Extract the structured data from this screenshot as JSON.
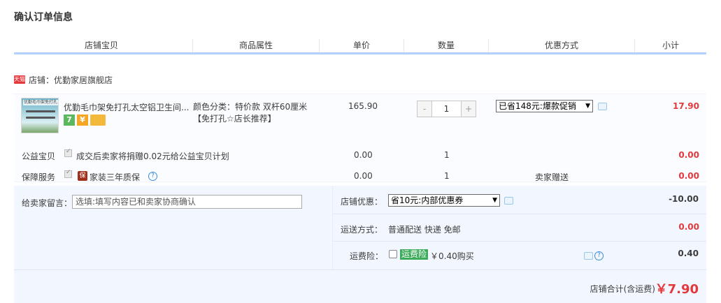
{
  "page_title": "确认订单信息",
  "columns": [
    "店铺宝贝",
    "商品属性",
    "单价",
    "数量",
    "优惠方式",
    "小计"
  ],
  "shop": {
    "badge": "天猫",
    "label": "店铺：",
    "name": "优勤家居旗舰店"
  },
  "item": {
    "thumb_caption": "优勤毛巾架免打孔",
    "title": "优勤毛巾架免打孔太空铝卫生间...",
    "attr_line1": "颜色分类：特价款 双杆60厘米",
    "attr_line2": "【免打孔☆店长推荐】",
    "price": "165.90",
    "quantity": "1",
    "qty_minus": "-",
    "qty_plus": "+",
    "discount_select": "已省148元:爆款促销",
    "subtotal": "17.90",
    "service_icons": [
      "7",
      "¥"
    ]
  },
  "services": [
    {
      "label": "公益宝贝",
      "desc": "成交后卖家将捐赠0.02元给公益宝贝计划",
      "price": "0.00",
      "qty": "1",
      "discount": "",
      "subtotal": "0.00"
    },
    {
      "label": "保障服务",
      "badge": "保",
      "desc": "家装三年质保",
      "price": "0.00",
      "qty": "1",
      "discount": "卖家赠送",
      "subtotal": "0.00"
    }
  ],
  "remark": {
    "label": "给卖家留言：",
    "placeholder": "选填:填写内容已和卖家协商确认"
  },
  "shop_discount": {
    "label": "店铺优惠：",
    "select": "省10元:内部优惠券",
    "value": "-10.00"
  },
  "shipping": {
    "label": "运送方式：",
    "value": "普通配送 快递 免邮",
    "amount": "0.00"
  },
  "insurance": {
    "label": "运费险：",
    "tag": "运费险",
    "price": "￥0.40购买",
    "amount": "0.40"
  },
  "total": {
    "label": "店铺合计(含运费)",
    "value": "￥7.90"
  },
  "colors": {
    "accent_red": "#e4393c",
    "header_border": "#b2d1ff",
    "panel_bg": "#f2f7ff",
    "insurance_green": "#3cab5a"
  }
}
